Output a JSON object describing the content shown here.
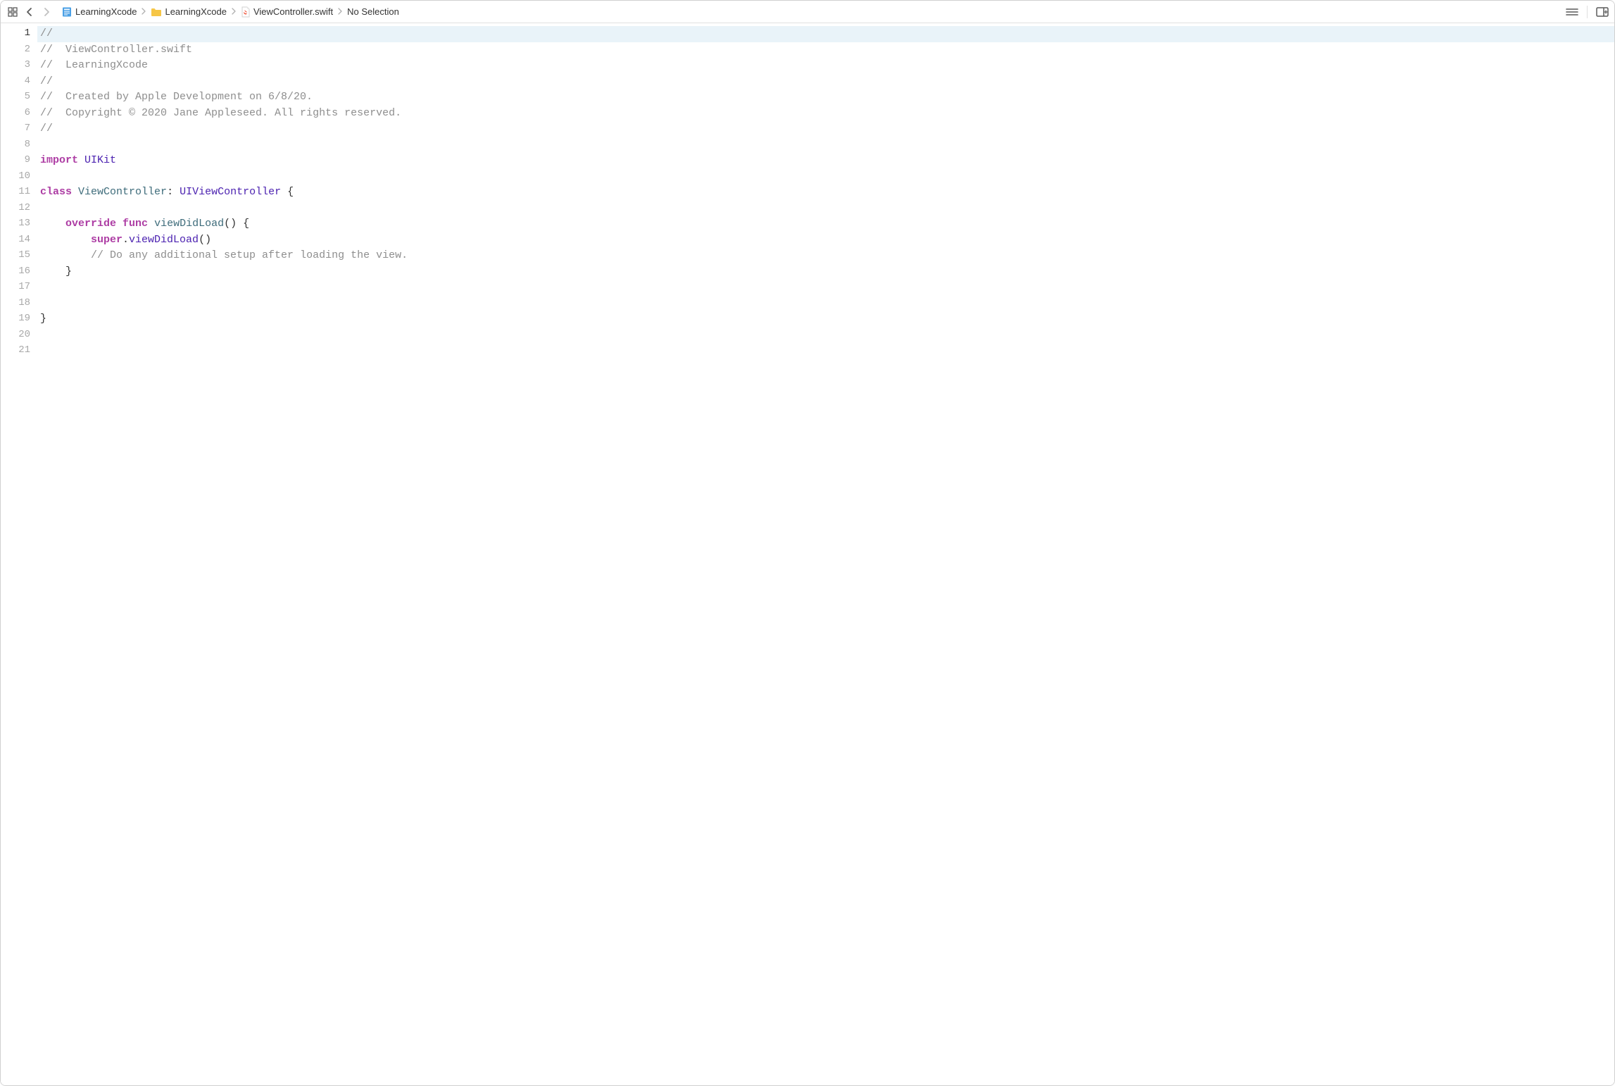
{
  "breadcrumbs": {
    "project": "LearningXcode",
    "group": "LearningXcode",
    "file": "ViewController.swift",
    "selection": "No Selection"
  },
  "icons": {
    "related_items": "related-items-icon",
    "back": "chevron-left-icon",
    "forward": "chevron-right-icon",
    "project": "project-icon",
    "folder": "folder-icon",
    "swift_file": "swift-file-icon",
    "adjust_options": "adjust-editor-options-icon",
    "add_editor": "add-editor-icon"
  },
  "nav": {
    "back_enabled": true,
    "forward_enabled": false
  },
  "editor": {
    "current_line": 1,
    "total_lines": 21,
    "lines": [
      {
        "n": 1,
        "tokens": [
          {
            "cls": "tok-comment",
            "t": "//"
          }
        ]
      },
      {
        "n": 2,
        "tokens": [
          {
            "cls": "tok-comment",
            "t": "//  ViewController.swift"
          }
        ]
      },
      {
        "n": 3,
        "tokens": [
          {
            "cls": "tok-comment",
            "t": "//  LearningXcode"
          }
        ]
      },
      {
        "n": 4,
        "tokens": [
          {
            "cls": "tok-comment",
            "t": "//"
          }
        ]
      },
      {
        "n": 5,
        "tokens": [
          {
            "cls": "tok-comment",
            "t": "//  Created by Apple Development on 6/8/20."
          }
        ]
      },
      {
        "n": 6,
        "tokens": [
          {
            "cls": "tok-comment",
            "t": "//  Copyright © 2020 Jane Appleseed. All rights reserved."
          }
        ]
      },
      {
        "n": 7,
        "tokens": [
          {
            "cls": "tok-comment",
            "t": "//"
          }
        ]
      },
      {
        "n": 8,
        "tokens": [
          {
            "cls": "tok-plain",
            "t": ""
          }
        ]
      },
      {
        "n": 9,
        "tokens": [
          {
            "cls": "tok-keyword",
            "t": "import"
          },
          {
            "cls": "tok-plain",
            "t": " "
          },
          {
            "cls": "tok-fw",
            "t": "UIKit"
          }
        ]
      },
      {
        "n": 10,
        "tokens": [
          {
            "cls": "tok-plain",
            "t": ""
          }
        ]
      },
      {
        "n": 11,
        "tokens": [
          {
            "cls": "tok-keyword",
            "t": "class"
          },
          {
            "cls": "tok-plain",
            "t": " "
          },
          {
            "cls": "tok-type",
            "t": "ViewController"
          },
          {
            "cls": "tok-plain",
            "t": ": "
          },
          {
            "cls": "tok-fw",
            "t": "UIViewController"
          },
          {
            "cls": "tok-plain",
            "t": " {"
          }
        ]
      },
      {
        "n": 12,
        "tokens": [
          {
            "cls": "tok-plain",
            "t": ""
          }
        ]
      },
      {
        "n": 13,
        "tokens": [
          {
            "cls": "tok-plain",
            "t": "    "
          },
          {
            "cls": "tok-keyword",
            "t": "override"
          },
          {
            "cls": "tok-plain",
            "t": " "
          },
          {
            "cls": "tok-keyword",
            "t": "func"
          },
          {
            "cls": "tok-plain",
            "t": " "
          },
          {
            "cls": "tok-func",
            "t": "viewDidLoad"
          },
          {
            "cls": "tok-plain",
            "t": "() {"
          }
        ]
      },
      {
        "n": 14,
        "tokens": [
          {
            "cls": "tok-plain",
            "t": "        "
          },
          {
            "cls": "tok-keyword",
            "t": "super"
          },
          {
            "cls": "tok-plain",
            "t": "."
          },
          {
            "cls": "tok-fw",
            "t": "viewDidLoad"
          },
          {
            "cls": "tok-plain",
            "t": "()"
          }
        ]
      },
      {
        "n": 15,
        "tokens": [
          {
            "cls": "tok-plain",
            "t": "        "
          },
          {
            "cls": "tok-comment",
            "t": "// Do any additional setup after loading the view."
          }
        ]
      },
      {
        "n": 16,
        "tokens": [
          {
            "cls": "tok-plain",
            "t": "    }"
          }
        ]
      },
      {
        "n": 17,
        "tokens": [
          {
            "cls": "tok-plain",
            "t": ""
          }
        ]
      },
      {
        "n": 18,
        "tokens": [
          {
            "cls": "tok-plain",
            "t": ""
          }
        ]
      },
      {
        "n": 19,
        "tokens": [
          {
            "cls": "tok-plain",
            "t": "}"
          }
        ]
      },
      {
        "n": 20,
        "tokens": [
          {
            "cls": "tok-plain",
            "t": ""
          }
        ]
      },
      {
        "n": 21,
        "tokens": [
          {
            "cls": "tok-plain",
            "t": ""
          }
        ]
      }
    ]
  }
}
